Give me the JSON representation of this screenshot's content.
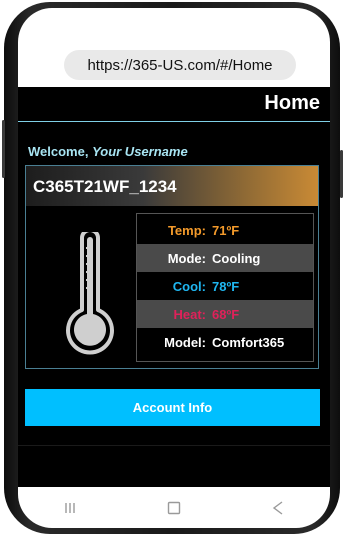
{
  "browser": {
    "url": "https://365-US.com/#/Home"
  },
  "header": {
    "title": "Home"
  },
  "welcome": {
    "prefix": "Welcome, ",
    "username": "Your Username"
  },
  "device": {
    "name": "C365T21WF_1234",
    "rows": [
      {
        "label": "Temp:",
        "value": "71ºF",
        "color": "#f39a2b",
        "bg": "#000000"
      },
      {
        "label": "Mode:",
        "value": "Cooling",
        "color": "#ffffff",
        "bg": "#4a4a4a"
      },
      {
        "label": "Cool:",
        "value": "78ºF",
        "color": "#1fb6f0",
        "bg": "#000000"
      },
      {
        "label": "Heat:",
        "value": "68ºF",
        "color": "#e0215a",
        "bg": "#4a4a4a"
      },
      {
        "label": "Model:",
        "value": "Comfort365",
        "color": "#ffffff",
        "bg": "#000000"
      }
    ]
  },
  "actions": {
    "account_label": "Account Info"
  },
  "nav": {
    "recent_icon": "|||",
    "home_icon": "□",
    "back_icon": "<"
  },
  "colors": {
    "accent": "#00bfff",
    "header_line": "#7fd0e6",
    "welcome": "#a8e4f2"
  }
}
